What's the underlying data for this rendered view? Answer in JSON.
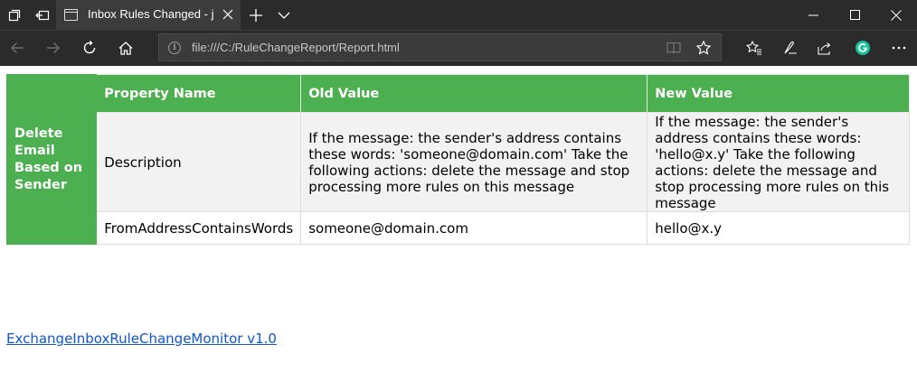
{
  "browser": {
    "tab_title": "Inbox Rules Changed - j",
    "url": "file:///C:/RuleChangeReport/Report.html"
  },
  "report": {
    "rule_name": "Delete Email Based on Sender",
    "headers": [
      "Property Name",
      "Old Value",
      "New Value"
    ],
    "rows": [
      {
        "property": "Description",
        "old_value": "If the message: the sender's address contains these words: 'someone@domain.com' Take the following actions: delete the message and stop processing more rules on this message",
        "new_value": "If the message: the sender's address contains these words: 'hello@x.y' Take the following actions: delete the message and stop processing more rules on this message"
      },
      {
        "property": "FromAddressContainsWords",
        "old_value": "someone@domain.com",
        "new_value": "hello@x.y"
      }
    ]
  },
  "footer": {
    "link_text": "ExchangeInboxRuleChangeMonitor v1.0"
  }
}
